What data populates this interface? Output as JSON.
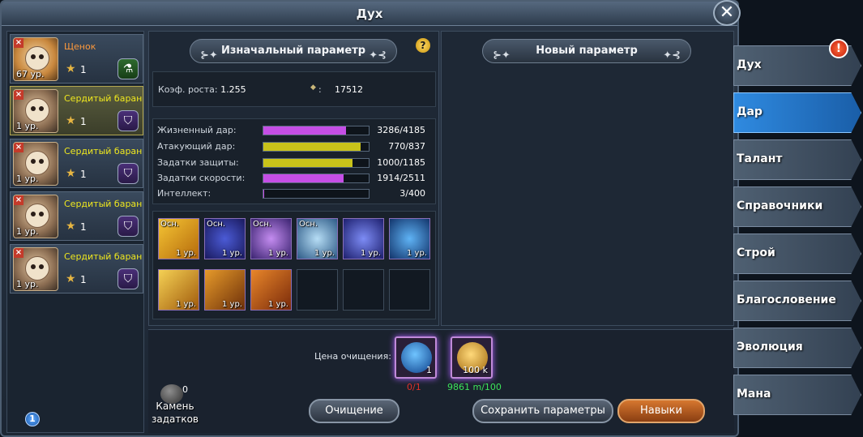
{
  "window": {
    "title": "Дух",
    "close_label": "✕"
  },
  "spirits": [
    {
      "name": "Щенок",
      "level": "67 ур.",
      "stars": "1",
      "badge": "potion"
    },
    {
      "name": "Сердитый баран",
      "level": "1 ур.",
      "stars": "1",
      "badge": "shield"
    },
    {
      "name": "Сердитый баран",
      "level": "1 ур.",
      "stars": "1",
      "badge": "shield"
    },
    {
      "name": "Сердитый баран",
      "level": "1 ур.",
      "stars": "1",
      "badge": "shield"
    },
    {
      "name": "Сердитый баран",
      "level": "1 ур.",
      "stars": "1",
      "badge": "shield"
    }
  ],
  "info_badge": "1",
  "original_params": {
    "header": "Изначальный параметр",
    "help": "?",
    "growth_label": "Коэф. роста:",
    "growth_value": "1.255",
    "second_label": ":",
    "second_value": "17512",
    "stats": [
      {
        "label": "Жизненный дар:",
        "value": "3286/4185",
        "fill": 0.785,
        "color": "#c54ee6"
      },
      {
        "label": "Атакующий дар:",
        "value": "770/837",
        "fill": 0.92,
        "color": "#c9c31a"
      },
      {
        "label": "Задатки защиты:",
        "value": "1000/1185",
        "fill": 0.844,
        "color": "#c9c31a"
      },
      {
        "label": "Задатки скорости:",
        "value": "1914/2511",
        "fill": 0.762,
        "color": "#c54ee6"
      },
      {
        "label": "Интеллект:",
        "value": "3/400",
        "fill": 0.0075,
        "color": "#c54ee6"
      }
    ],
    "skills": [
      {
        "tag": "Осн.",
        "level": "1 ур.",
        "gradient": "linear-gradient(135deg,#f5c534,#b56a0c)"
      },
      {
        "tag": "Осн.",
        "level": "1 ур.",
        "gradient": "radial-gradient(#4b5bd6,#1a1a5e)"
      },
      {
        "tag": "Осн.",
        "level": "1 ур.",
        "gradient": "radial-gradient(#c48cf0,#3a2370)"
      },
      {
        "tag": "Осн.",
        "level": "1 ур.",
        "gradient": "radial-gradient(#b6ddf5,#2d5a86)"
      },
      {
        "tag": "",
        "level": "1 ур.",
        "gradient": "radial-gradient(#7d8cf5,#1d1f6e)"
      },
      {
        "tag": "",
        "level": "1 ур.",
        "gradient": "radial-gradient(#5fb3f5,#12346b)"
      },
      {
        "tag": "",
        "level": "1 ур.",
        "gradient": "linear-gradient(135deg,#f5d154,#a05a0c)"
      },
      {
        "tag": "",
        "level": "1 ур.",
        "gradient": "linear-gradient(135deg,#e69a2a,#6e300a)"
      },
      {
        "tag": "",
        "level": "1 ур.",
        "gradient": "linear-gradient(135deg,#e8862a,#7a2a0a)"
      }
    ]
  },
  "new_params": {
    "header": "Новый параметр"
  },
  "purify": {
    "price_label": "Цена очищения:",
    "cost1_qty": "1",
    "cost1_status": "0/1",
    "cost2_qty": "100 k",
    "cost2_status": "9861 m/100",
    "stone_count": "0",
    "stone_label": "Камень задатков"
  },
  "buttons": {
    "purify": "Очищение",
    "save": "Сохранить параметры",
    "skills": "Навыки"
  },
  "tabs": [
    "Дух",
    "Дар",
    "Талант",
    "Справочники",
    "Строй",
    "Благословение",
    "Эволюция",
    "Мана"
  ],
  "active_tab": "Дар",
  "alert": "!",
  "colors": {
    "accent_blue": "#1f78d1",
    "gold_text": "#f0e81e",
    "red_text": "#e0302a",
    "green_text": "#3de35a"
  }
}
